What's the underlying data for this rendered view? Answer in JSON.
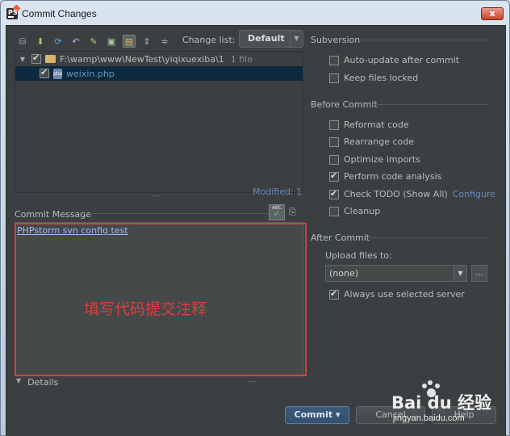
{
  "window": {
    "title": "Commit Changes",
    "close_glyph": "x"
  },
  "toolbar": {
    "icons": [
      "vcs-icon",
      "update-icon",
      "refresh-icon",
      "rollback-icon",
      "diff-icon",
      "move-icon",
      "group-icon",
      "expand-all-icon",
      "collapse-all-icon"
    ],
    "change_list_label": "Change list:",
    "change_list_value": "Default"
  },
  "changes": {
    "root_path": "F:\\wamp\\www\\NewTest\\yiqixuexiba\\1",
    "root_count": "1 file",
    "file_name": "weixin.php",
    "modified_text": "Modified: 1"
  },
  "commit_message": {
    "label": "Commit Message",
    "text": "PHPstorm svn config test"
  },
  "annotation": {
    "text": "填写代码提交注释",
    "color": "#e03c3c"
  },
  "details_label": "Details",
  "subversion": {
    "heading": "Subversion",
    "options": [
      {
        "label": "Auto-update after commit",
        "checked": false
      },
      {
        "label": "Keep files locked",
        "checked": false
      }
    ]
  },
  "before_commit": {
    "heading": "Before Commit",
    "options": [
      {
        "label": "Reformat code",
        "checked": false
      },
      {
        "label": "Rearrange code",
        "checked": false
      },
      {
        "label": "Optimize imports",
        "checked": false
      },
      {
        "label": "Perform code analysis",
        "checked": true
      },
      {
        "label": "Check TODO (Show All)",
        "checked": true,
        "link": "Configure"
      },
      {
        "label": "Cleanup",
        "checked": false
      }
    ]
  },
  "after_commit": {
    "heading": "After Commit",
    "upload_label": "Upload files to:",
    "upload_value": "(none)",
    "more_button": "...",
    "always_selected": {
      "label": "Always use selected server",
      "checked": true
    }
  },
  "buttons": {
    "commit": "Commit",
    "commit_arrow": "▾",
    "cancel": "Cancel",
    "help": "Help"
  },
  "watermark": {
    "brand": "Bai du 经验",
    "url": "jingyan.baidu.com"
  }
}
